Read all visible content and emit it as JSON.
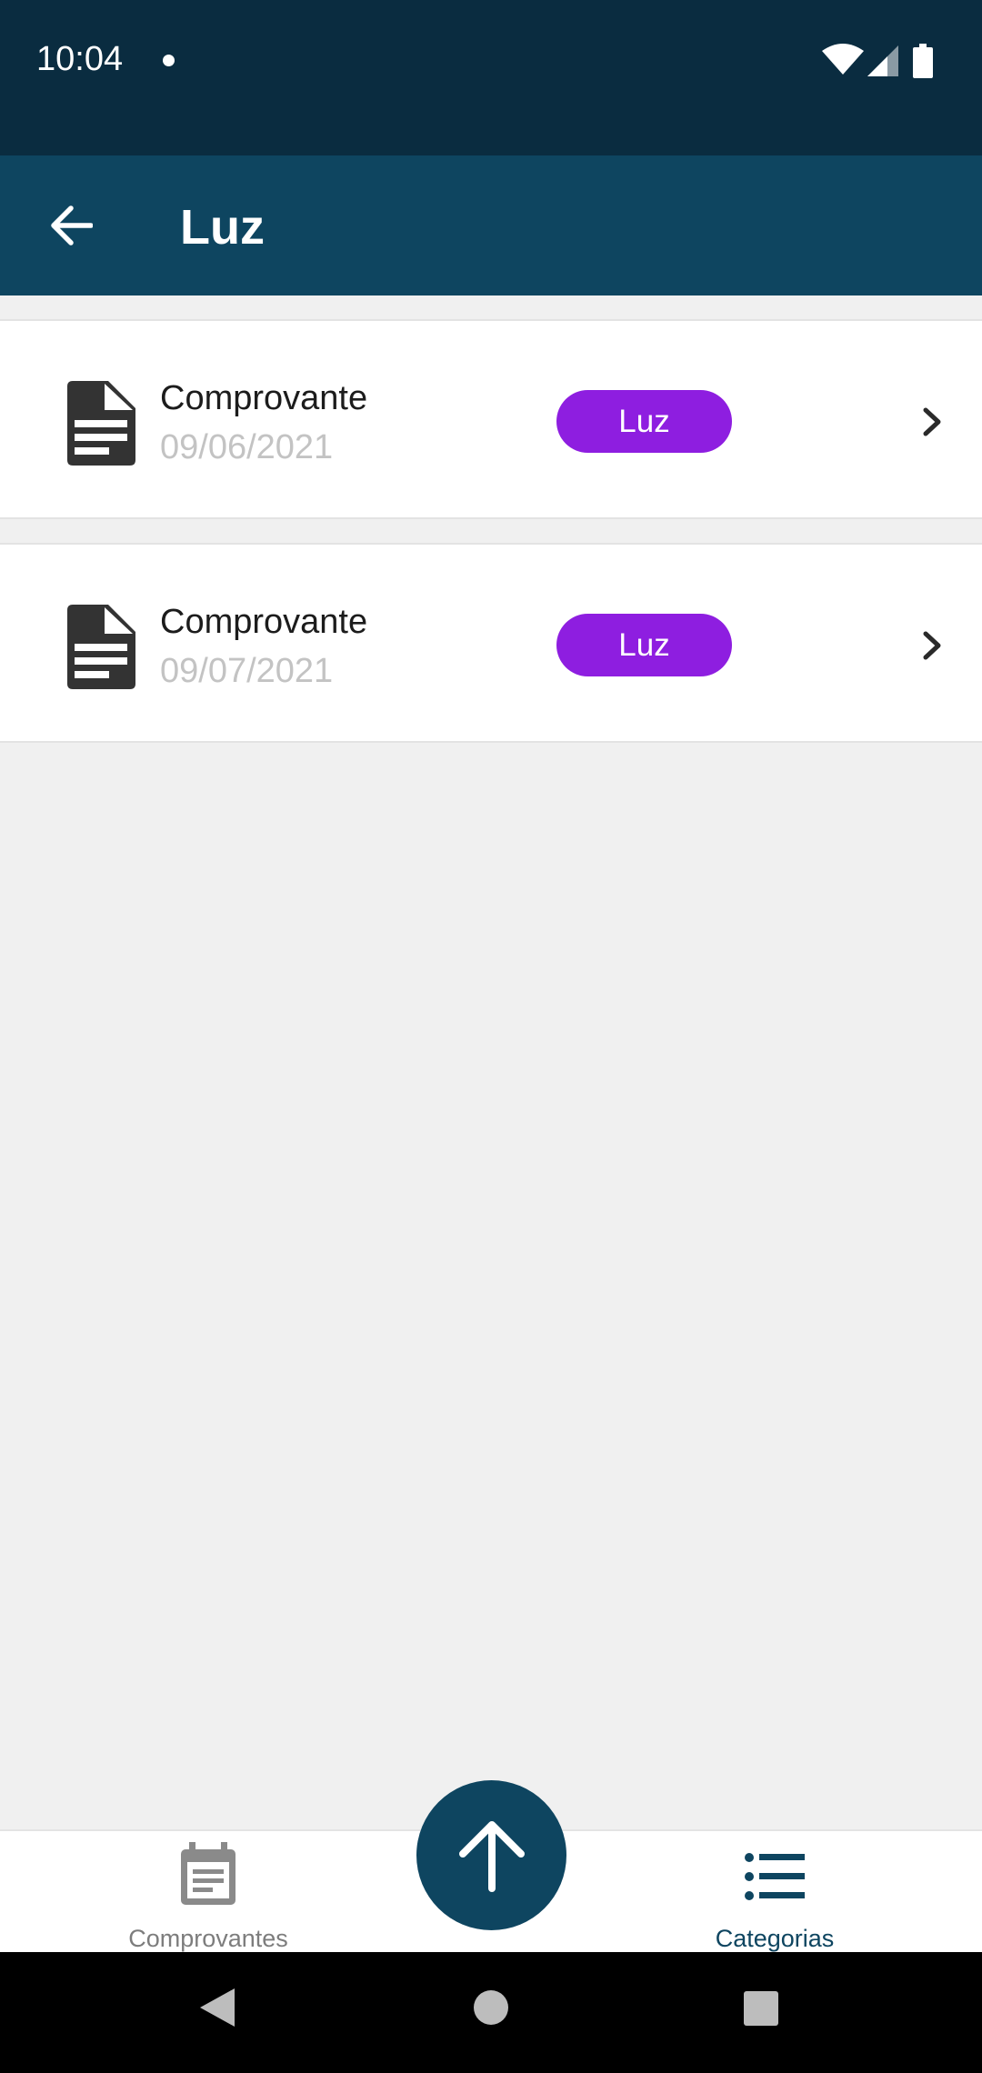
{
  "status_bar": {
    "time": "10:04",
    "icons": [
      "notification-dot-icon",
      "wifi-icon",
      "cell-signal-icon",
      "battery-icon"
    ]
  },
  "app_bar": {
    "title": "Luz",
    "back_icon": "arrow-left-icon"
  },
  "items": [
    {
      "title": "Comprovante",
      "date": "09/06/2021",
      "tag": "Luz",
      "tag_color": "#8e1ee0",
      "icon": "document-icon"
    },
    {
      "title": "Comprovante",
      "date": "09/07/2021",
      "tag": "Luz",
      "tag_color": "#8e1ee0",
      "icon": "document-icon"
    }
  ],
  "bottom_nav": {
    "left": {
      "label": "Comprovantes",
      "icon": "calendar-note-icon"
    },
    "fab": {
      "icon": "arrow-up-icon"
    },
    "right": {
      "label": "Categorias",
      "icon": "list-icon",
      "active": true
    }
  },
  "colors": {
    "status_bar": "#0a2c40",
    "app_bar": "#0e4560",
    "accent": "#0e4560",
    "tag": "#8e1ee0"
  }
}
